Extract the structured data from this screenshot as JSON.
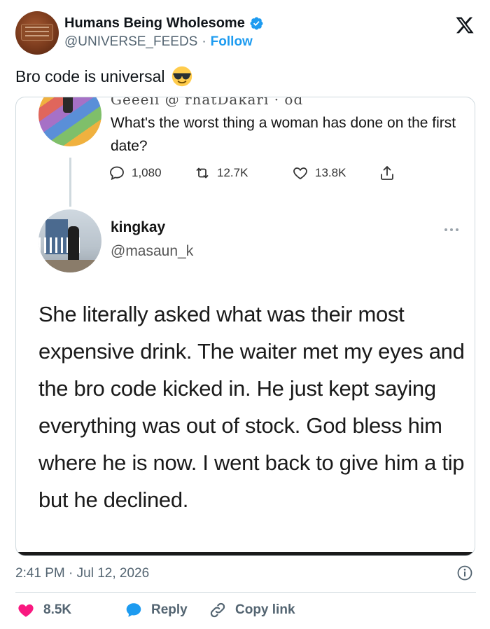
{
  "header": {
    "display_name": "Humans Being Wholesome",
    "handle": "@UNIVERSE_FEEDS",
    "separator": "·",
    "follow_label": "Follow",
    "x_logo": "x-logo-icon",
    "verified_icon": "verified-badge-icon",
    "colors": {
      "accent": "#1d9bf0",
      "secondary_text": "#536471"
    }
  },
  "tweet": {
    "text": "Bro code is universal",
    "emoji": "smiling-face-with-sunglasses"
  },
  "embedded_screenshot": {
    "cut_off_header": "Geeeii @ rhatDakari · od",
    "question": {
      "text": "What's the worst thing a woman has done on the first date?",
      "replies": "1,080",
      "retweets": "12.7K",
      "likes": "13.8K"
    },
    "reply": {
      "author_name": "kingkay",
      "author_handle": "@masaun_k",
      "text": "She literally asked what was their most expensive drink. The waiter met my eyes and the bro code kicked in. He just kept saying everything was out of stock. God bless him where he is now. I went back to give him a tip but he declined."
    }
  },
  "meta": {
    "timestamp": "2:41 PM · Jul 12, 2026"
  },
  "actions": {
    "likes_count": "8.5K",
    "reply_label": "Reply",
    "copy_link_label": "Copy link",
    "colors": {
      "heart": "#f91880",
      "reply": "#1d9bf0"
    }
  }
}
